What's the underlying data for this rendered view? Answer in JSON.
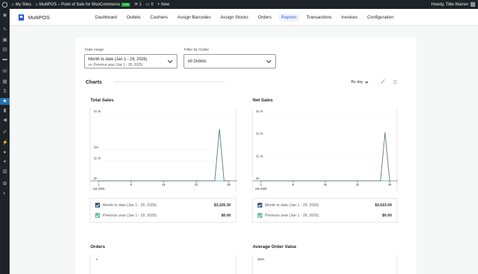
{
  "admin_bar": {
    "my_sites": "My Sites",
    "site_name": "MultiPOS – Point of Sale for WooCommerce",
    "live_badge": "Live",
    "updates_count": "1",
    "comments_count": "0",
    "new_label": "New",
    "howdy": "Howdy, Tillie Warren"
  },
  "nav": {
    "brand": "MultiPOS",
    "items": [
      "Dashboard",
      "Outlets",
      "Cashiers",
      "Assign Barcodes",
      "Assign Stocks",
      "Orders",
      "Reports",
      "Transactions",
      "Invoices",
      "Configuration"
    ],
    "active": "Reports"
  },
  "filters": {
    "date_range_label": "Date range:",
    "date_range_value": "Month to date (Jan 1 - 29, 2026)",
    "date_range_compare": "vs. Previous year (Jan 1 - 28, 2025)",
    "outlet_label": "Filter by Outlet",
    "outlet_value": "All Outlets"
  },
  "charts_section": {
    "title": "Charts",
    "interval": "By day",
    "line_icon": "line-chart-icon",
    "bar_icon": "bar-chart-icon"
  },
  "colors": {
    "primary_series": "#50707e",
    "previous_series": "#5ec68f",
    "accent": "#2d5bd6",
    "checkbox_primary": "#3f5d7d",
    "checkbox_previous": "#5ec68f"
  },
  "chart_data": [
    {
      "type": "line",
      "title": "Total Sales",
      "y_ticks": [
        "$0",
        "$1.3k",
        "$2k",
        "$4.3k"
      ],
      "x_ticks": [
        "1",
        "8",
        "15",
        "22",
        "29"
      ],
      "x_sublabel": "Jan 2026",
      "x": [
        1,
        2,
        3,
        4,
        5,
        6,
        7,
        8,
        9,
        10,
        11,
        12,
        13,
        14,
        15,
        16,
        17,
        18,
        19,
        20,
        21,
        22,
        23,
        24,
        25,
        26,
        27,
        28,
        29
      ],
      "series": [
        {
          "name": "Month to date (Jan 1 - 29, 2026)",
          "values": [
            0,
            0,
            0,
            0,
            0,
            0,
            0,
            0,
            0,
            0,
            0,
            0,
            0,
            0,
            0,
            0,
            0,
            0,
            0,
            0,
            0,
            0,
            0,
            0,
            0,
            0,
            3325.3,
            0,
            0
          ]
        },
        {
          "name": "Previous year (Jan 1 - 29, 2025)",
          "values": [
            0,
            0,
            0,
            0,
            0,
            0,
            0,
            0,
            0,
            0,
            0,
            0,
            0,
            0,
            0,
            0,
            0,
            0,
            0,
            0,
            0,
            0,
            0,
            0,
            0,
            0,
            0,
            0,
            0
          ]
        }
      ],
      "legend": [
        {
          "label": "Month to date (Jan 1 - 29, 2026)",
          "value": "$3,325.30"
        },
        {
          "label": "Previous year (Jan 1 - 29, 2025)",
          "value": "$0.00"
        }
      ]
    },
    {
      "type": "line",
      "title": "Net Sales",
      "y_ticks": [
        "$0",
        "$1.4k",
        "$2.8k",
        "$4.2k"
      ],
      "x_ticks": [
        "1",
        "8",
        "15",
        "22",
        "29"
      ],
      "x_sublabel": "Jan 2026",
      "x": [
        1,
        2,
        3,
        4,
        5,
        6,
        7,
        8,
        9,
        10,
        11,
        12,
        13,
        14,
        15,
        16,
        17,
        18,
        19,
        20,
        21,
        22,
        23,
        24,
        25,
        26,
        27,
        28,
        29
      ],
      "series": [
        {
          "name": "Month to date (Jan 1 - 29, 2026)",
          "values": [
            0,
            0,
            0,
            0,
            0,
            0,
            0,
            0,
            0,
            0,
            0,
            0,
            0,
            0,
            0,
            0,
            0,
            0,
            0,
            0,
            0,
            0,
            0,
            0,
            0,
            0,
            0,
            3023.0,
            0
          ]
        },
        {
          "name": "Previous year (Jan 1 - 29, 2025)",
          "values": [
            0,
            0,
            0,
            0,
            0,
            0,
            0,
            0,
            0,
            0,
            0,
            0,
            0,
            0,
            0,
            0,
            0,
            0,
            0,
            0,
            0,
            0,
            0,
            0,
            0,
            0,
            0,
            0,
            0
          ]
        }
      ],
      "legend": [
        {
          "label": "Month to date (Jan 1 - 29, 2026)",
          "value": "$3,023.00"
        },
        {
          "label": "Previous year (Jan 1 - 29, 2025)",
          "value": "$0.00"
        }
      ]
    }
  ],
  "lower_charts": {
    "orders_title": "Orders",
    "orders_top_tick": "4",
    "aov_title": "Average Order Value",
    "aov_top_tick": "$880"
  },
  "sidebar_icons": [
    "dashboard-icon",
    "pin-icon",
    "media-icon",
    "pages-icon",
    "comments-icon",
    "woocommerce-icon",
    "products-icon",
    "payments-icon",
    "multipos-icon",
    "analytics-icon",
    "marketing-icon",
    "appearance-icon",
    "plugins-icon",
    "users-icon",
    "tools-icon",
    "settings-icon",
    "collapse-icon"
  ]
}
